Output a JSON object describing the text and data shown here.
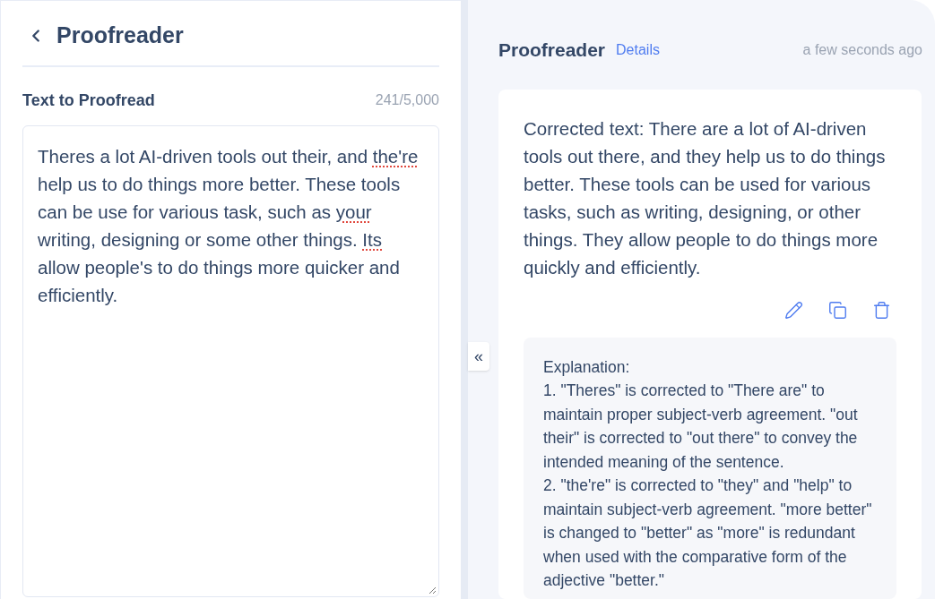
{
  "left_panel": {
    "title": "Proofreader",
    "field_label": "Text to Proofread",
    "char_count": "241/5,000",
    "input_segments": [
      {
        "text": "Theres a lot AI-driven tools out their, and ",
        "misspelled": false
      },
      {
        "text": "the're",
        "misspelled": true
      },
      {
        "text": " help us to do things more better. These tools can be use for various task, such as ",
        "misspelled": false
      },
      {
        "text": "your",
        "misspelled": true
      },
      {
        "text": " writing, designing or some other things. ",
        "misspelled": false
      },
      {
        "text": "Its",
        "misspelled": true
      },
      {
        "text": " allow people's to do things more quicker and efficiently.",
        "misspelled": false
      }
    ]
  },
  "collapse_button": {
    "label": "«"
  },
  "right_panel": {
    "title": "Proofreader",
    "details_link": "Details",
    "timestamp": "a few seconds ago",
    "result": {
      "corrected_text": "Corrected text: There are a lot of AI-driven tools out there, and they help us to do things better. These tools can be used for various tasks, such as writing, designing, or other things. They allow people to do things more quickly and efficiently.",
      "actions": [
        {
          "kind": "edit"
        },
        {
          "kind": "copy"
        },
        {
          "kind": "delete"
        }
      ],
      "explanation_lines": [
        "Explanation:",
        "1. \"Theres\" is corrected to \"There are\" to maintain proper subject-verb agreement. \"out their\" is corrected to \"out there\" to convey the intended meaning of the sentence.",
        "2. \"the're\" is corrected to \"they\" and \"help\" to maintain subject-verb agreement. \"more better\" is changed to \"better\" as \"more\" is redundant when used with the comparative form of the adjective \"better.\""
      ]
    }
  }
}
